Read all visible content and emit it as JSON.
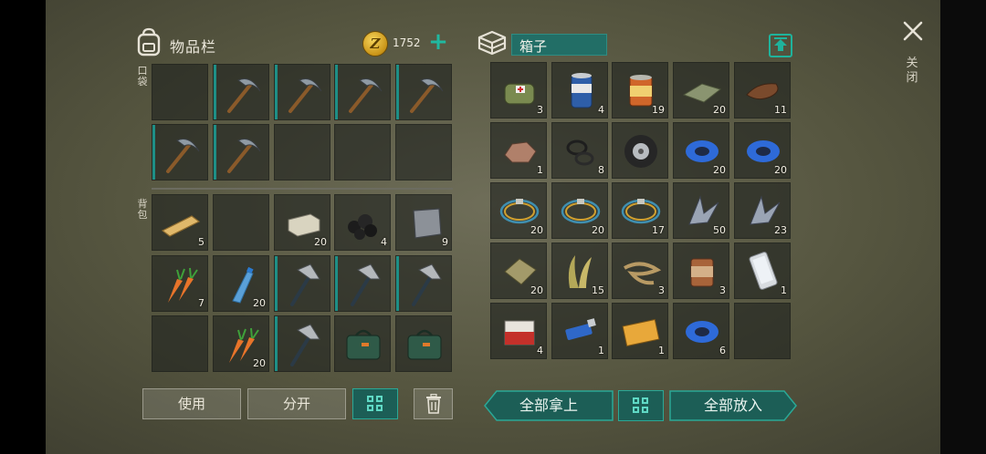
{
  "inventory": {
    "title": "物品栏",
    "coins": "1752",
    "pocket_label": "口袋",
    "backpack_label": "背包",
    "pocket_slots": [
      {
        "item": "",
        "qty": "",
        "icon": "empty"
      },
      {
        "item": "pickaxe",
        "qty": "",
        "icon": "pickaxe-icon"
      },
      {
        "item": "pickaxe",
        "qty": "",
        "icon": "pickaxe-icon"
      },
      {
        "item": "pickaxe",
        "qty": "",
        "icon": "pickaxe-icon"
      },
      {
        "item": "pickaxe",
        "qty": "",
        "icon": "pickaxe-icon"
      },
      {
        "item": "pickaxe",
        "qty": "",
        "icon": "pickaxe-icon"
      },
      {
        "item": "pickaxe",
        "qty": "",
        "icon": "pickaxe-icon"
      },
      {
        "item": "",
        "qty": "",
        "icon": "empty"
      },
      {
        "item": "",
        "qty": "",
        "icon": "empty"
      },
      {
        "item": "",
        "qty": "",
        "icon": "empty"
      }
    ],
    "backpack_slots": [
      {
        "item": "plank",
        "qty": "5",
        "icon": "plank-icon"
      },
      {
        "item": "",
        "qty": "",
        "icon": "empty"
      },
      {
        "item": "stone",
        "qty": "20",
        "icon": "stone-block-icon"
      },
      {
        "item": "coal",
        "qty": "4",
        "icon": "coal-icon"
      },
      {
        "item": "iron plate",
        "qty": "9",
        "icon": "metal-plate-icon"
      },
      {
        "item": "carrot",
        "qty": "7",
        "icon": "carrot-icon"
      },
      {
        "item": "water bottle",
        "qty": "20",
        "icon": "water-bottle-icon"
      },
      {
        "item": "hatchet",
        "qty": "",
        "icon": "hatchet-icon"
      },
      {
        "item": "hatchet",
        "qty": "",
        "icon": "hatchet-icon"
      },
      {
        "item": "hatchet",
        "qty": "",
        "icon": "hatchet-icon"
      },
      {
        "item": "",
        "qty": "",
        "icon": "empty"
      },
      {
        "item": "carrot",
        "qty": "20",
        "icon": "carrot-icon"
      },
      {
        "item": "hatchet",
        "qty": "",
        "icon": "hatchet-icon"
      },
      {
        "item": "medkit bag",
        "qty": "",
        "icon": "medkit-bag-icon"
      },
      {
        "item": "medkit bag",
        "qty": "",
        "icon": "medkit-bag-icon"
      }
    ],
    "buttons": {
      "use": "使用",
      "split": "分开"
    }
  },
  "box": {
    "title": "箱子",
    "slots": [
      {
        "item": "bandage bag",
        "qty": "3",
        "icon": "first-aid-pouch-icon"
      },
      {
        "item": "beer can",
        "qty": "4",
        "icon": "beer-can-icon"
      },
      {
        "item": "canned food",
        "qty": "19",
        "icon": "food-can-icon"
      },
      {
        "item": "cloth",
        "qty": "20",
        "icon": "cloth-icon"
      },
      {
        "item": "leather",
        "qty": "11",
        "icon": "leather-icon"
      },
      {
        "item": "ore",
        "qty": "1",
        "icon": "ore-icon"
      },
      {
        "item": "rubber rings",
        "qty": "8",
        "icon": "rubber-ring-icon"
      },
      {
        "item": "tire",
        "qty": "",
        "icon": "tire-icon"
      },
      {
        "item": "tape",
        "qty": "20",
        "icon": "tape-icon"
      },
      {
        "item": "tape",
        "qty": "20",
        "icon": "tape-icon"
      },
      {
        "item": "wire",
        "qty": "20",
        "icon": "wire-icon"
      },
      {
        "item": "wire",
        "qty": "20",
        "icon": "wire-icon"
      },
      {
        "item": "wire",
        "qty": "17",
        "icon": "wire-icon"
      },
      {
        "item": "scrap metal",
        "qty": "50",
        "icon": "scrap-metal-icon"
      },
      {
        "item": "scrap metal",
        "qty": "23",
        "icon": "scrap-metal-icon"
      },
      {
        "item": "sandbag",
        "qty": "20",
        "icon": "sandbag-icon"
      },
      {
        "item": "plant fiber",
        "qty": "15",
        "icon": "plant-fiber-icon"
      },
      {
        "item": "rope",
        "qty": "3",
        "icon": "rope-icon"
      },
      {
        "item": "rusty can",
        "qty": "3",
        "icon": "rusty-can-icon"
      },
      {
        "item": "phone",
        "qty": "1",
        "icon": "phone-icon"
      },
      {
        "item": "cigarettes",
        "qty": "4",
        "icon": "cigarette-pack-icon"
      },
      {
        "item": "usb stick",
        "qty": "1",
        "icon": "usb-stick-icon"
      },
      {
        "item": "coupon",
        "qty": "1",
        "icon": "coupon-icon"
      },
      {
        "item": "tape",
        "qty": "6",
        "icon": "tape-icon"
      },
      {
        "item": "",
        "qty": "",
        "icon": "empty"
      }
    ],
    "buttons": {
      "take_all": "全部拿上",
      "put_all": "全部放入"
    }
  },
  "close": {
    "label": "关闭"
  },
  "colors": {
    "accent": "#1fb39c",
    "teal_dark": "#1c5e56",
    "slot_bg": "#1e221e"
  }
}
